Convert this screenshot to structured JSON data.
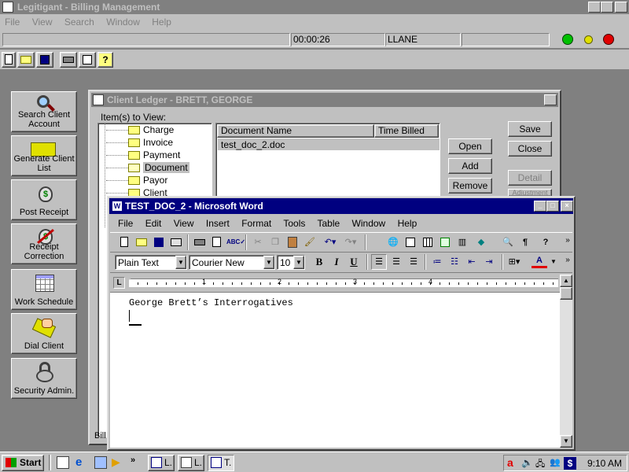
{
  "app": {
    "title": "Legitigant - Billing Management",
    "menu": [
      "File",
      "View",
      "Search",
      "Window",
      "Help"
    ],
    "status": {
      "timer": "00:00:26",
      "user": "LLANE"
    },
    "lights": {
      "green": "#00c000",
      "yellow": "#e0e000",
      "red": "#e00000"
    }
  },
  "nav": [
    {
      "label": "Search Client Account",
      "icon": "magnifier-icon"
    },
    {
      "label": "Generate Client List",
      "icon": "folder-icon"
    },
    {
      "label": "Post Receipt",
      "icon": "money-bag-icon"
    },
    {
      "label": "Receipt Correction",
      "icon": "money-bag-cancel-icon"
    },
    {
      "label": "Work Schedule",
      "icon": "calendar-icon"
    },
    {
      "label": "Dial Client",
      "icon": "phone-hand-icon"
    },
    {
      "label": "Security Admin.",
      "icon": "padlock-icon"
    }
  ],
  "ledger": {
    "title": "Client Ledger - BRETT, GEORGE",
    "items_label": "Item(s) to View:",
    "tree": [
      "Charge",
      "Invoice",
      "Payment",
      "Document",
      "Payor",
      "Client"
    ],
    "selected": "Document",
    "columns": [
      "Document Name",
      "Time Billed"
    ],
    "rows": [
      {
        "name": "test_doc_2.doc",
        "time": ""
      }
    ],
    "buttons": {
      "open": "Open",
      "add": "Add",
      "remove": "Remove"
    },
    "side_buttons": {
      "save": "Save",
      "close": "Close",
      "detail": "Detail",
      "adjustment": "Adjustment"
    },
    "bottom_fragment": "Bill"
  },
  "word": {
    "title": "TEST_DOC_2 - Microsoft Word",
    "menu": [
      "File",
      "Edit",
      "View",
      "Insert",
      "Format",
      "Tools",
      "Table",
      "Window",
      "Help"
    ],
    "style": "Plain Text",
    "font": "Courier New",
    "size": "10",
    "ruler": [
      "1",
      "2",
      "3",
      "4"
    ],
    "text": "George Brett’s Interrogatives"
  },
  "taskbar": {
    "start": "Start",
    "clock": "9:10 AM",
    "tasks": [
      "L.",
      "L.",
      "T."
    ]
  }
}
